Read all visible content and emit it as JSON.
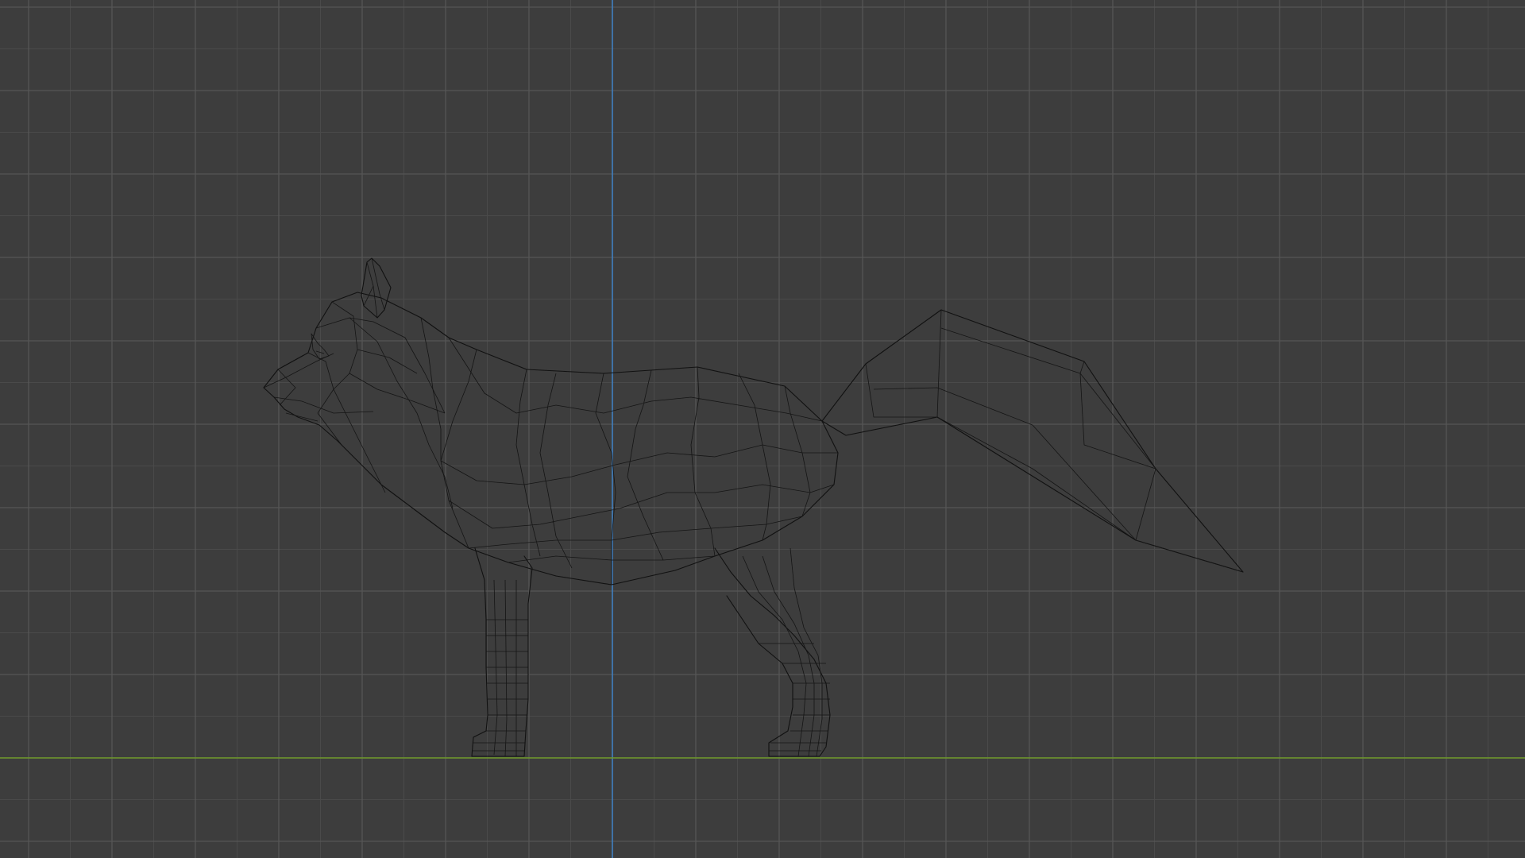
{
  "viewport": {
    "background_color": "#3d3d3d",
    "minor_grid_color": "#4a4a4a",
    "major_grid_color": "#565656",
    "x_axis_color": "#6f9a2a",
    "z_axis_color": "#3f7fbf",
    "wireframe_color": "#111111"
  },
  "object": {
    "icon": "wireframe-fox-mesh"
  }
}
